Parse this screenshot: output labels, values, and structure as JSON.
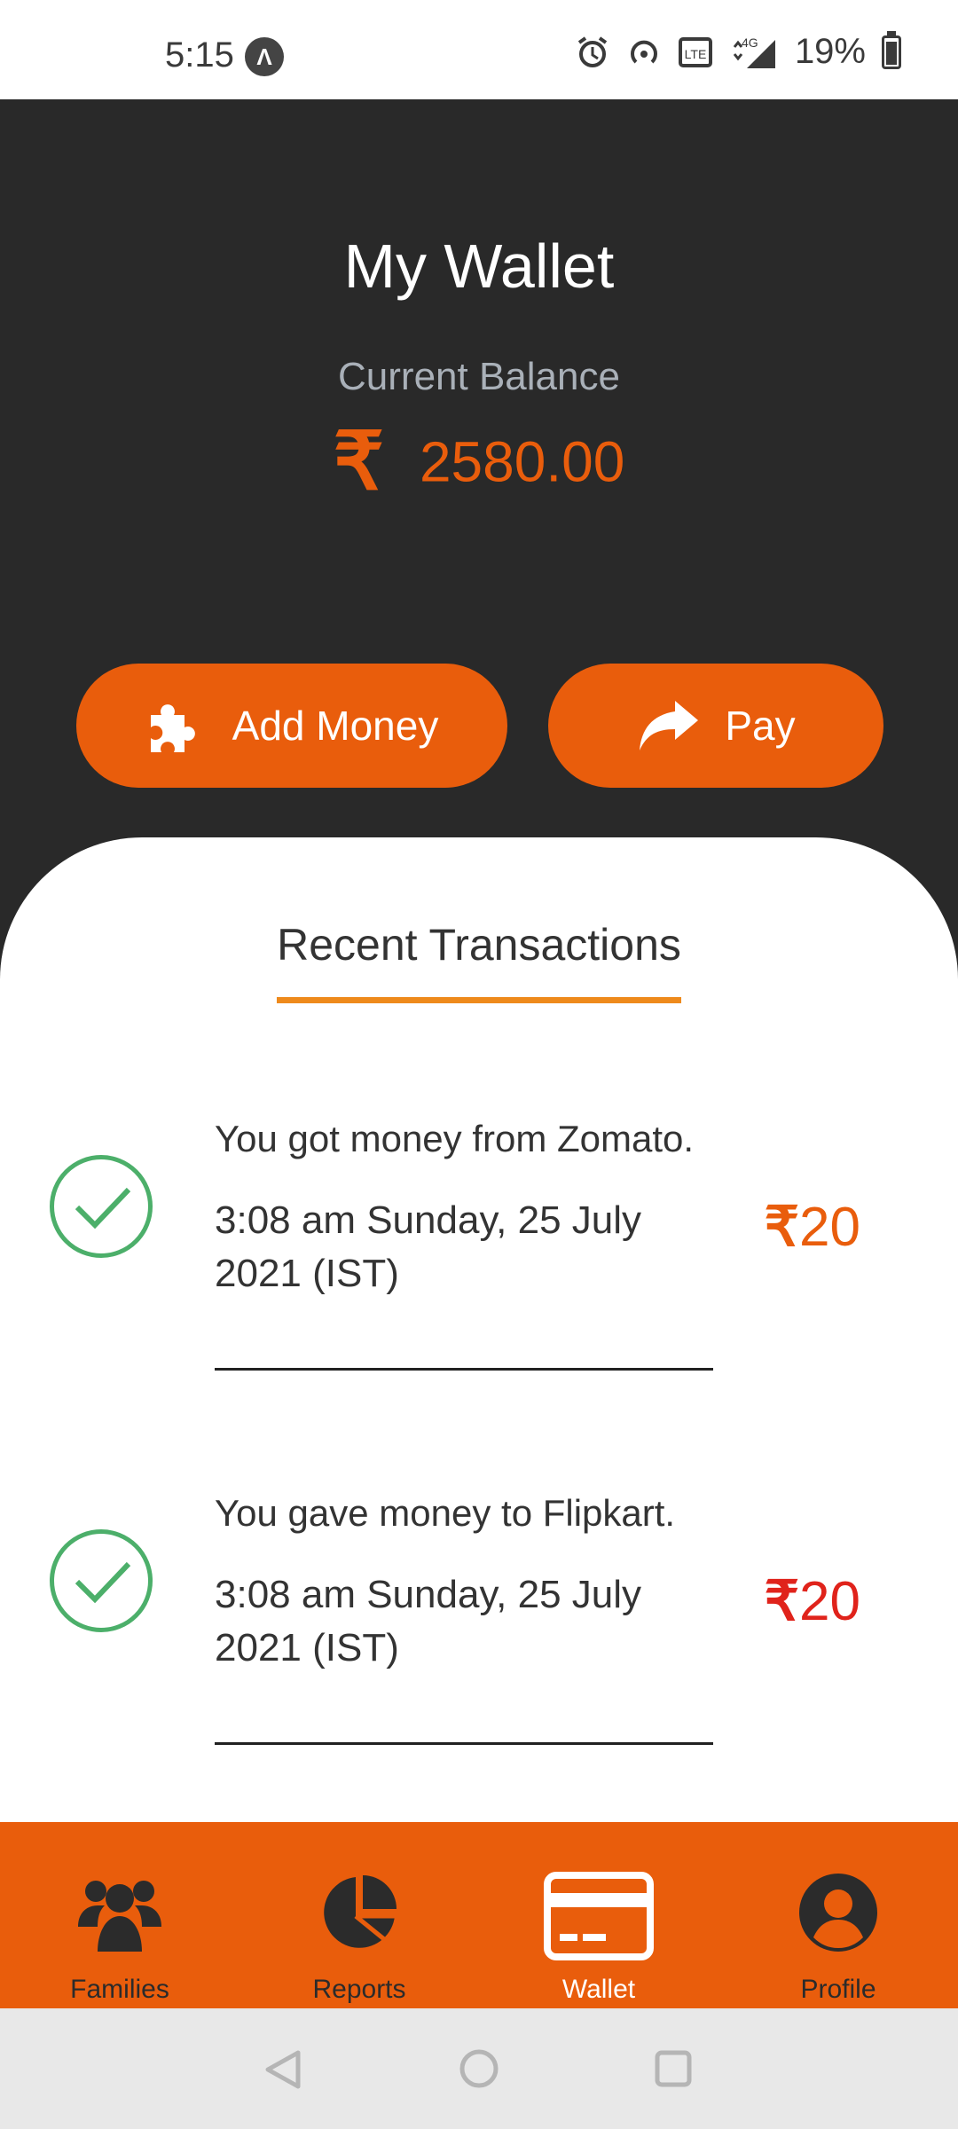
{
  "status_bar": {
    "time": "5:15",
    "badge": "Λ",
    "battery_percent": "19%",
    "icons": [
      "alarm-icon",
      "hotspot-icon",
      "volte-icon",
      "signal-4g-icon",
      "battery-icon"
    ]
  },
  "header": {
    "title": "My Wallet",
    "balance_label": "Current Balance",
    "currency_symbol": "₹",
    "balance": "2580.00"
  },
  "actions": {
    "add_money_label": "Add Money",
    "add_money_icon": "puzzle-icon",
    "pay_label": "Pay",
    "pay_icon": "share-arrow-icon"
  },
  "transactions": {
    "title": "Recent Transactions",
    "items": [
      {
        "description": "You got money from Zomato.",
        "timestamp": "3:08 am Sunday, 25 July 2021 (IST)",
        "currency": "₹",
        "amount": "20",
        "amount_color": "#e95d0c",
        "status_icon": "check-circle-icon"
      },
      {
        "description": "You gave money to Flipkart.",
        "timestamp": "3:08 am Sunday, 25 July 2021 (IST)",
        "currency": "₹",
        "amount": "20",
        "amount_color": "#e0231b",
        "status_icon": "check-circle-icon"
      }
    ]
  },
  "bottom_nav": {
    "items": [
      {
        "label": "Families",
        "icon": "families-icon"
      },
      {
        "label": "Reports",
        "icon": "pie-chart-icon"
      },
      {
        "label": "Wallet",
        "icon": "wallet-card-icon",
        "active": true
      },
      {
        "label": "Profile",
        "icon": "profile-icon"
      }
    ]
  },
  "colors": {
    "accent": "#e95d0c",
    "header_bg": "#292929",
    "underline": "#ee8a1c",
    "success": "#4caf6a"
  }
}
